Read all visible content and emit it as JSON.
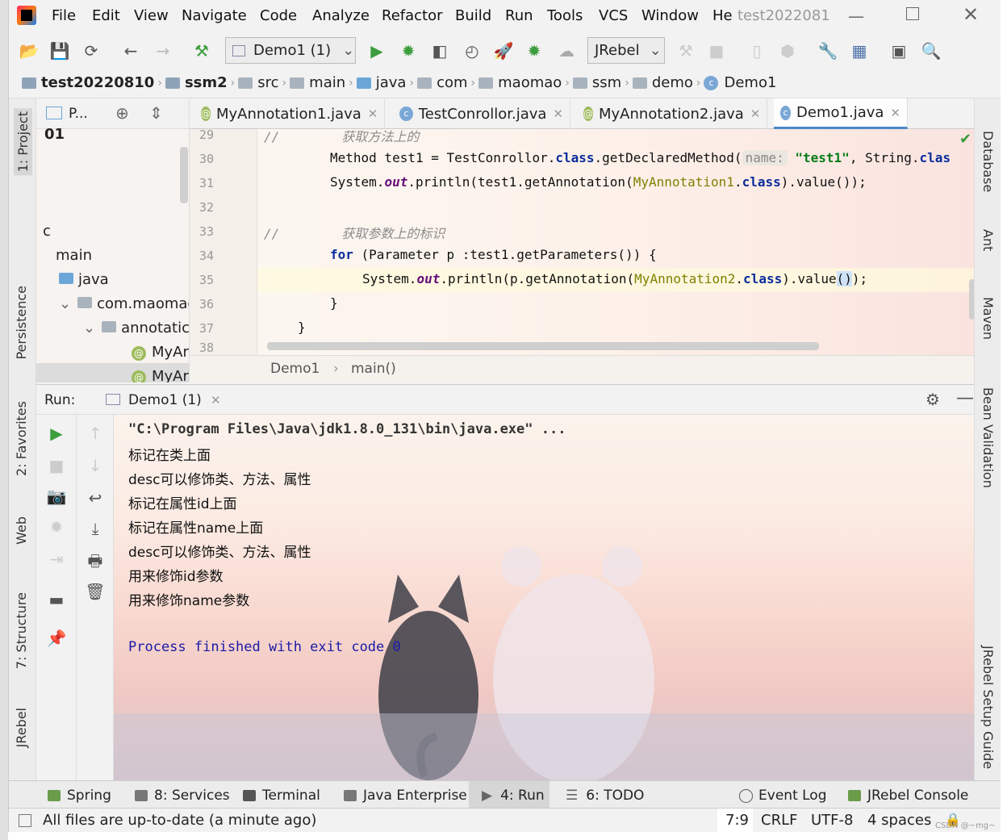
{
  "app": {
    "title": "test2022081"
  },
  "menu": [
    "File",
    "Edit",
    "View",
    "Navigate",
    "Code",
    "Analyze",
    "Refactor",
    "Build",
    "Run",
    "Tools",
    "VCS",
    "Window",
    "He"
  ],
  "toolbar": {
    "run_config": "Demo1 (1)",
    "jrebel": "JRebel"
  },
  "breadcrumb": [
    "test20220810",
    "ssm2",
    "src",
    "main",
    "java",
    "com",
    "maomao",
    "ssm",
    "demo",
    "Demo1"
  ],
  "left_tabs": {
    "project": "1: Project",
    "persistence": "Persistence",
    "favorites": "2: Favorites",
    "web": "Web",
    "structure": "7: Structure",
    "jrebel": "JRebel"
  },
  "right_tabs": {
    "database": "Database",
    "ant": "Ant",
    "maven": "Maven",
    "bean": "Bean Validation",
    "jrebel_guide": "JRebel Setup Guide"
  },
  "project": {
    "header": "P...",
    "items": [
      "c",
      "main",
      "java",
      "com.maomac",
      "annotatic",
      "MyAr",
      "MyAr"
    ],
    "top_label": "01"
  },
  "editor_tabs": [
    "MyAnnotation1.java",
    "TestConrollor.java",
    "MyAnnotation2.java",
    "Demo1.java"
  ],
  "code": {
    "lines": [
      "29",
      "30",
      "31",
      "32",
      "33",
      "34",
      "35",
      "36",
      "37",
      "38"
    ],
    "l29_comment": "//        获取方法上的",
    "l30_a": "Method test1 = TestConrollor.",
    "l30_kw": "class",
    "l30_b": ".getDeclaredMethod(",
    "l30_hint": "name:",
    "l30_str": "\"test1\"",
    "l30_c": ", String.",
    "l30_kw2": "clas",
    "l31_a": "System.",
    "l31_out": "out",
    "l31_b": ".println(test1.getAnnotation(",
    "l31_ann": "MyAnnotation1",
    "l31_c": ".",
    "l31_kw": "class",
    "l31_d": ").value());",
    "l33_comment": "//        获取参数上的标识",
    "l34_kw": "for",
    "l34_b": " (Parameter p :test1.getParameters()) {",
    "l35_a": "System.",
    "l35_out": "out",
    "l35_b": ".println(p.getAnnotation(",
    "l35_ann": "MyAnnotation2",
    "l35_c": ".",
    "l35_kw": "class",
    "l35_d": ").value",
    "l35_paren": "()",
    "l35_e": ");",
    "l36": "}",
    "l37": "}"
  },
  "editor_breadcrumb": {
    "cls": "Demo1",
    "method": "main()"
  },
  "run": {
    "label": "Run:",
    "tab": "Demo1 (1)"
  },
  "console": [
    "\"C:\\Program Files\\Java\\jdk1.8.0_131\\bin\\java.exe\" ...",
    "标记在类上面",
    "desc可以修饰类、方法、属性",
    "标记在属性id上面",
    "标记在属性name上面",
    "desc可以修饰类、方法、属性",
    "用来修饰id参数",
    "用来修饰name参数",
    "",
    "Process finished with exit code 0"
  ],
  "bottom_tabs": [
    "Spring",
    "8: Services",
    "Terminal",
    "Java Enterprise",
    "4: Run",
    "6: TODO",
    "Event Log",
    "JRebel Console"
  ],
  "status": {
    "message": "All files are up-to-date (a minute ago)",
    "pos": "7:9",
    "eol": "CRLF",
    "enc": "UTF-8",
    "indent": "4 spaces",
    "watermark": "CSDN @~mg~"
  },
  "colors": {
    "accent": "#4a88c7",
    "keyword": "#0b2d9c",
    "string": "#067d17",
    "annotation": "#808000",
    "run_green": "#3c9d3c"
  }
}
